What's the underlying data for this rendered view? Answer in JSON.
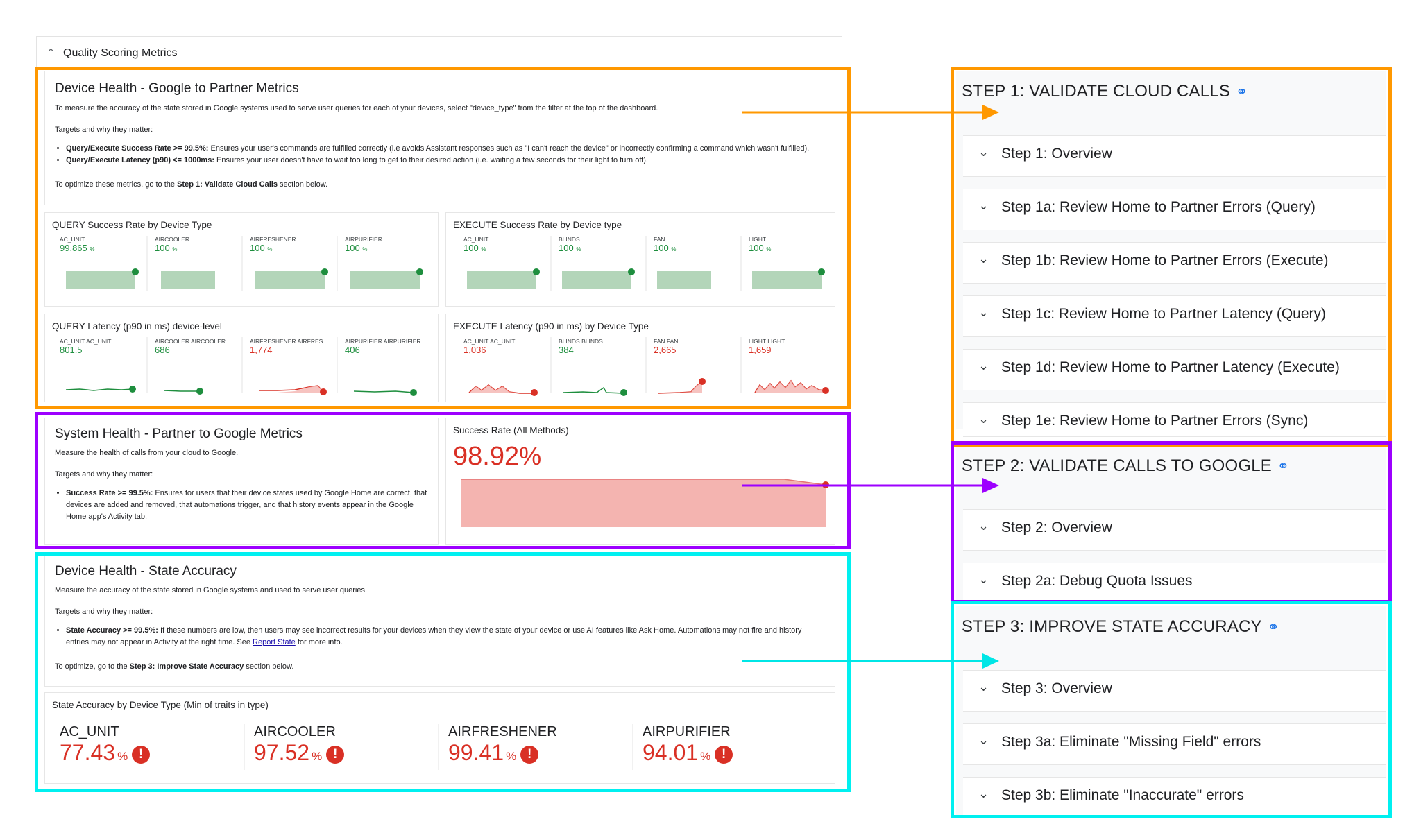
{
  "header": {
    "title": "Quality Scoring Metrics"
  },
  "device_health": {
    "title": "Device Health - Google to Partner Metrics",
    "intro": "To measure the accuracy of the state stored in Google systems used to serve user queries for each of your devices, select \"device_type\" from the filter at the top of the dashboard.",
    "targets_label": "Targets and why they matter:",
    "bullet1_bold": "Query/Execute Success Rate >= 99.5%:",
    "bullet1_text": " Ensures your user's commands are fulfilled correctly (i.e avoids Assistant responses such as \"I can't reach the device\" or incorrectly confirming a command which wasn't fulfilled).",
    "bullet2_bold": "Query/Execute Latency (p90) <= 1000ms:",
    "bullet2_text": " Ensures your user doesn't have to wait too long to get to their desired action (i.e. waiting a few seconds for their light to turn off).",
    "optimize_pre": "To optimize these metrics, go to the ",
    "optimize_bold": "Step 1: Validate Cloud Calls",
    "optimize_post": " section below."
  },
  "panels": {
    "query_success": {
      "title": "QUERY Success Rate by Device Type",
      "items": [
        {
          "label": "AC_UNIT",
          "value": "99.865",
          "unit": "%"
        },
        {
          "label": "AIRCOOLER",
          "value": "100",
          "unit": "%"
        },
        {
          "label": "AIRFRESHENER",
          "value": "100",
          "unit": "%"
        },
        {
          "label": "AIRPURIFIER",
          "value": "100",
          "unit": "%"
        }
      ]
    },
    "execute_success": {
      "title": "EXECUTE Success Rate by Device type",
      "items": [
        {
          "label": "AC_UNIT",
          "value": "100",
          "unit": "%"
        },
        {
          "label": "BLINDS",
          "value": "100",
          "unit": "%"
        },
        {
          "label": "FAN",
          "value": "100",
          "unit": "%"
        },
        {
          "label": "LIGHT",
          "value": "100",
          "unit": "%"
        }
      ]
    },
    "query_latency": {
      "title": "QUERY Latency (p90 in ms) device-level",
      "items": [
        {
          "label": "AC_UNIT AC_UNIT",
          "value": "801.5"
        },
        {
          "label": "AIRCOOLER AIRCOOLER",
          "value": "686"
        },
        {
          "label": "AIRFRESHENER AIRFRES...",
          "value": "1,774"
        },
        {
          "label": "AIRPURIFIER AIRPURIFIER",
          "value": "406"
        }
      ]
    },
    "execute_latency": {
      "title": "EXECUTE Latency (p90 in ms) by Device Type",
      "items": [
        {
          "label": "AC_UNIT AC_UNIT",
          "value": "1,036"
        },
        {
          "label": "BLINDS BLINDS",
          "value": "384"
        },
        {
          "label": "FAN FAN",
          "value": "2,665"
        },
        {
          "label": "LIGHT LIGHT",
          "value": "1,659"
        }
      ]
    }
  },
  "system_health": {
    "title": "System Health - Partner to Google Metrics",
    "intro": "Measure the health of calls from your cloud to Google.",
    "targets_label": "Targets and why they matter:",
    "bullet_bold": "Success Rate >= 99.5%:",
    "bullet_text": " Ensures for users that their device states used by Google Home are correct, that devices are added and removed, that automations trigger, and that history events appear in the Google Home app's Activity tab.",
    "rate_label": "Success Rate (All Methods)",
    "rate_value": "98.92",
    "rate_unit": "%"
  },
  "state_accuracy": {
    "title": "Device Health - State Accuracy",
    "intro": "Measure the accuracy of the state stored in Google systems and used to serve user queries.",
    "targets_label": "Targets and why they matter:",
    "bullet_bold": "State Accuracy >= 99.5%:",
    "bullet_text": " If these numbers are low, then users may see incorrect results for your devices when they view the state of your device or use AI features like Ask Home. Automations may not fire and history entries may not appear in Activity at the right time. See ",
    "bullet_link": "Report State",
    "bullet_post": " for more info.",
    "optimize_pre": "To optimize, go to the ",
    "optimize_bold": "Step 3: Improve State Accuracy",
    "optimize_post": " section below.",
    "panel_title": "State Accuracy by Device Type (Min of traits in type)",
    "items": [
      {
        "label": "AC_UNIT",
        "value": "77.43",
        "unit": "%"
      },
      {
        "label": "AIRCOOLER",
        "value": "97.52",
        "unit": "%"
      },
      {
        "label": "AIRFRESHENER",
        "value": "99.41",
        "unit": "%"
      },
      {
        "label": "AIRPURIFIER",
        "value": "94.01",
        "unit": "%"
      }
    ]
  },
  "steps": {
    "step1": {
      "title": "STEP 1: VALIDATE CLOUD CALLS",
      "items": [
        "Step 1: Overview",
        "Step 1a: Review Home to Partner Errors (Query)",
        "Step 1b: Review Home to Partner Errors (Execute)",
        "Step 1c: Review Home to Partner Latency (Query)",
        "Step 1d: Review Home to Partner Latency (Execute)",
        "Step 1e: Review Home to Partner Errors (Sync)"
      ]
    },
    "step2": {
      "title": "STEP 2: VALIDATE CALLS TO GOOGLE",
      "items": [
        "Step 2: Overview",
        "Step 2a: Debug Quota Issues"
      ]
    },
    "step3": {
      "title": "STEP 3: IMPROVE STATE ACCURACY",
      "items": [
        "Step 3: Overview",
        "Step 3a: Eliminate \"Missing Field\" errors",
        "Step 3b: Eliminate \"Inaccurate\" errors"
      ]
    }
  },
  "icons": {
    "chevron_up": "chevron-up-icon",
    "chevron_down": "chevron-down-icon",
    "link": "link-icon",
    "error": "error-icon"
  },
  "colors": {
    "orange": "#ff9800",
    "purple": "#9d00ff",
    "cyan": "#00f0f0",
    "green": "#1e8e3e",
    "red": "#d93025",
    "bar_green": "#b3d5b9",
    "area_red": "#f4b4b0"
  }
}
